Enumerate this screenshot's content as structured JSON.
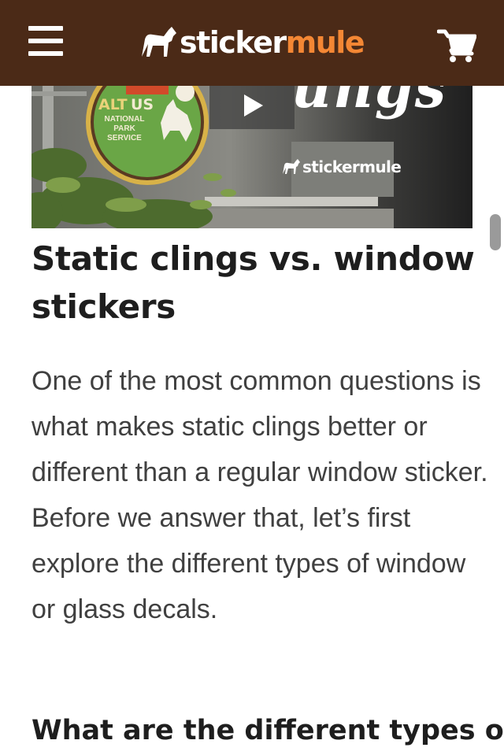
{
  "header": {
    "logo_prefix": "sticker",
    "logo_suffix": "mule",
    "menu_icon": "hamburger-menu-icon",
    "cart_icon": "shopping-cart-icon",
    "background_color": "#4b2a17",
    "logo_accent_color": "#f48734"
  },
  "video": {
    "badge_alt": "ALT",
    "badge_us": "US",
    "badge_line1": "NATIONAL",
    "badge_line2": "PARK",
    "badge_line3": "SERVICE",
    "script_word": "ungs",
    "watermark": "stickermule",
    "play_icon": "play-icon"
  },
  "article": {
    "title": "Static clings vs. window stickers",
    "paragraph": "One of the most common questions is what makes static clings better or different than a regular window sticker. Before we answer that, let’s first explore the different types of window or glass decals.",
    "subheading": "What are the different types of"
  }
}
